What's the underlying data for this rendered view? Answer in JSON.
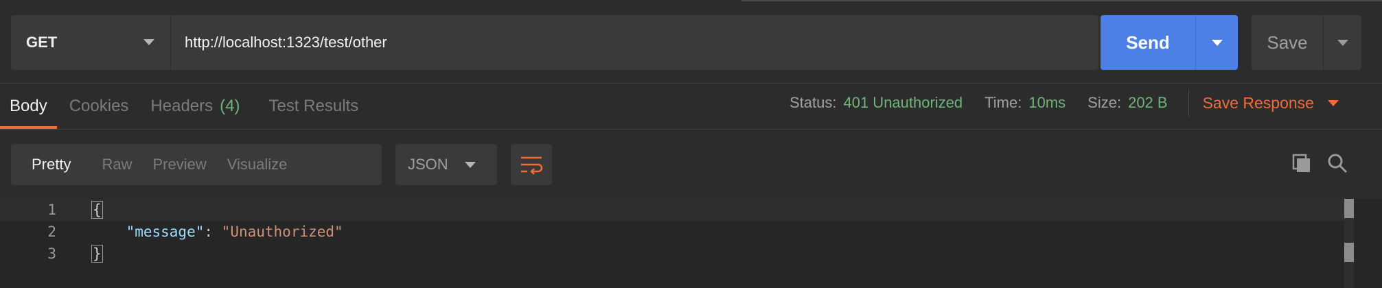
{
  "request": {
    "method": "GET",
    "url": "http://localhost:1323/test/other",
    "send_label": "Send",
    "save_label": "Save"
  },
  "response_tabs": [
    {
      "label": "Body",
      "active": true
    },
    {
      "label": "Cookies",
      "active": false
    },
    {
      "label": "Headers",
      "count": "(4)",
      "active": false
    },
    {
      "label": "Test Results",
      "active": false
    }
  ],
  "status": {
    "status_label": "Status:",
    "status_value": "401 Unauthorized",
    "time_label": "Time:",
    "time_value": "10ms",
    "size_label": "Size:",
    "size_value": "202 B",
    "save_response_label": "Save Response"
  },
  "view_modes": [
    "Pretty",
    "Raw",
    "Preview",
    "Visualize"
  ],
  "format": "JSON",
  "editor": {
    "line_numbers": [
      "1",
      "2",
      "3"
    ],
    "open_brace": "{",
    "key": "\"message\"",
    "colon": ": ",
    "value": "\"Unauthorized\"",
    "close_brace": "}"
  },
  "colors": {
    "accent": "#f26b3a",
    "send": "#4d80e6",
    "success": "#6db477"
  },
  "icons": [
    "chevron-down-icon",
    "wrap-lines-icon",
    "copy-icon",
    "search-icon"
  ]
}
